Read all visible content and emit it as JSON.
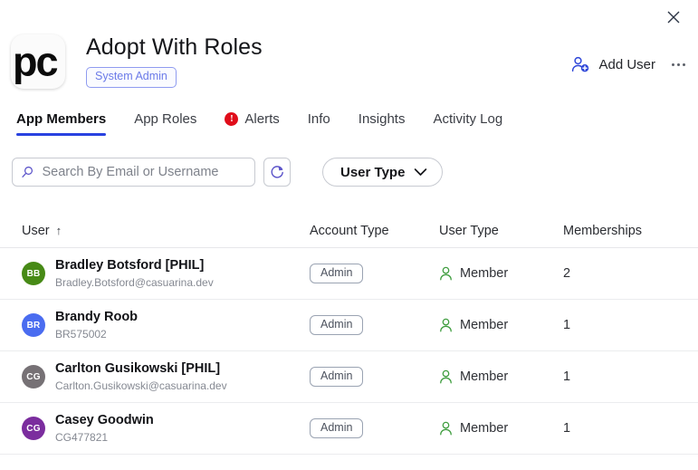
{
  "window": {
    "close_label": "×"
  },
  "header": {
    "logo_text": "pc",
    "logo_icon": "app-logo-icon",
    "title": "Adopt With Roles",
    "badge": "System Admin",
    "add_user_label": "Add User",
    "add_user_icon": "add-user-icon",
    "more_icon": "more-options-icon",
    "close_icon": "close-icon",
    "accent_color": "#2942e0",
    "badge_color": "#6b7ae8"
  },
  "tabs": [
    {
      "label": "App Members",
      "active": true,
      "icon": null
    },
    {
      "label": "App Roles",
      "active": false,
      "icon": null
    },
    {
      "label": "Alerts",
      "active": false,
      "icon": "alert-icon",
      "icon_glyph": "!",
      "icon_color": "#e00d1a"
    },
    {
      "label": "Info",
      "active": false,
      "icon": null
    },
    {
      "label": "Insights",
      "active": false,
      "icon": null
    },
    {
      "label": "Activity Log",
      "active": false,
      "icon": null
    }
  ],
  "filters": {
    "search_placeholder": "Search By Email or Username",
    "search_value": "",
    "search_icon": "search-icon",
    "refresh_icon": "refresh-icon",
    "user_type_label": "User Type",
    "chevron_icon": "chevron-down-icon"
  },
  "table": {
    "columns": {
      "user": "User",
      "sort_indicator": "↑",
      "account_type": "Account Type",
      "user_type": "User Type",
      "memberships": "Memberships"
    },
    "rows": [
      {
        "initials": "BB",
        "avatar_color": "#478a16",
        "name": "Bradley Botsford [PHIL]",
        "sub": "Bradley.Botsford@casuarina.dev",
        "account_type": "Admin",
        "user_type": "Member",
        "user_type_icon": "person-icon",
        "user_type_icon_color": "#3f9d3f",
        "memberships": "2"
      },
      {
        "initials": "BR",
        "avatar_color": "#4a6cf0",
        "name": "Brandy Roob",
        "sub": "BR575002",
        "account_type": "Admin",
        "user_type": "Member",
        "user_type_icon": "person-icon",
        "user_type_icon_color": "#3f9d3f",
        "memberships": "1"
      },
      {
        "initials": "CG",
        "avatar_color": "#767175",
        "name": "Carlton Gusikowski [PHIL]",
        "sub": "Carlton.Gusikowski@casuarina.dev",
        "account_type": "Admin",
        "user_type": "Member",
        "user_type_icon": "person-icon",
        "user_type_icon_color": "#3f9d3f",
        "memberships": "1"
      },
      {
        "initials": "CG",
        "avatar_color": "#7b2d9e",
        "name": "Casey Goodwin",
        "sub": "CG477821",
        "account_type": "Admin",
        "user_type": "Member",
        "user_type_icon": "person-icon",
        "user_type_icon_color": "#3f9d3f",
        "memberships": "1"
      }
    ]
  }
}
